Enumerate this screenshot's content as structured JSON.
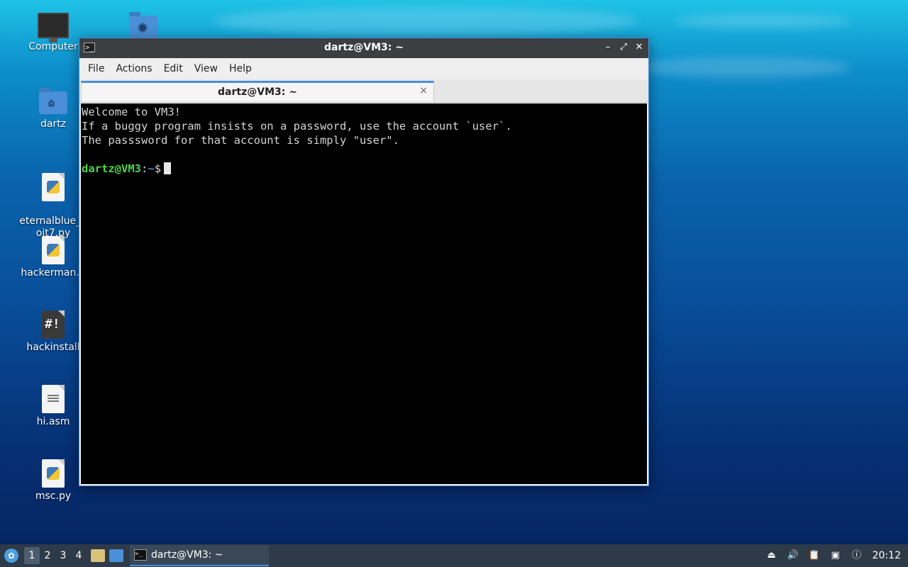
{
  "desktop": {
    "icons": [
      {
        "label": "Computer",
        "icon": "computer-icon"
      },
      {
        "label": "dartz",
        "icon": "home-folder-icon"
      },
      {
        "label": "eternalblue_e\noit7.py",
        "icon": "python-file-icon"
      },
      {
        "label": "hackerman.p",
        "icon": "python-file-icon"
      },
      {
        "label": "hackinstall",
        "icon": "script-file-icon"
      },
      {
        "label": "hi.asm",
        "icon": "text-file-icon"
      },
      {
        "label": "msc.py",
        "icon": "python-file-icon"
      }
    ],
    "network_folder_icon": "network-folder-icon"
  },
  "window": {
    "title": "dartz@VM3: ~",
    "menu": [
      "File",
      "Actions",
      "Edit",
      "View",
      "Help"
    ],
    "tab_label": "dartz@VM3: ~",
    "tab_close": "×",
    "controls": {
      "minimize": "–",
      "maximize": "⤢",
      "close": "✕"
    }
  },
  "terminal": {
    "lines": [
      "Welcome to VM3!",
      "If a buggy program insists on a password, use the account `user`.",
      "The passsword for that account is simply \"user\".",
      ""
    ],
    "prompt_user": "dartz@VM3",
    "prompt_sep": ":",
    "prompt_path": "~",
    "prompt_symbol": "$"
  },
  "taskbar": {
    "workspaces": [
      "1",
      "2",
      "3",
      "4"
    ],
    "active_workspace": "1",
    "task_label": "dartz@VM3: ~",
    "clock": "20:12"
  },
  "colors": {
    "prompt_user": "#4ed34a",
    "prompt_path": "#4a8bd8",
    "accent": "#4a8fd8"
  }
}
